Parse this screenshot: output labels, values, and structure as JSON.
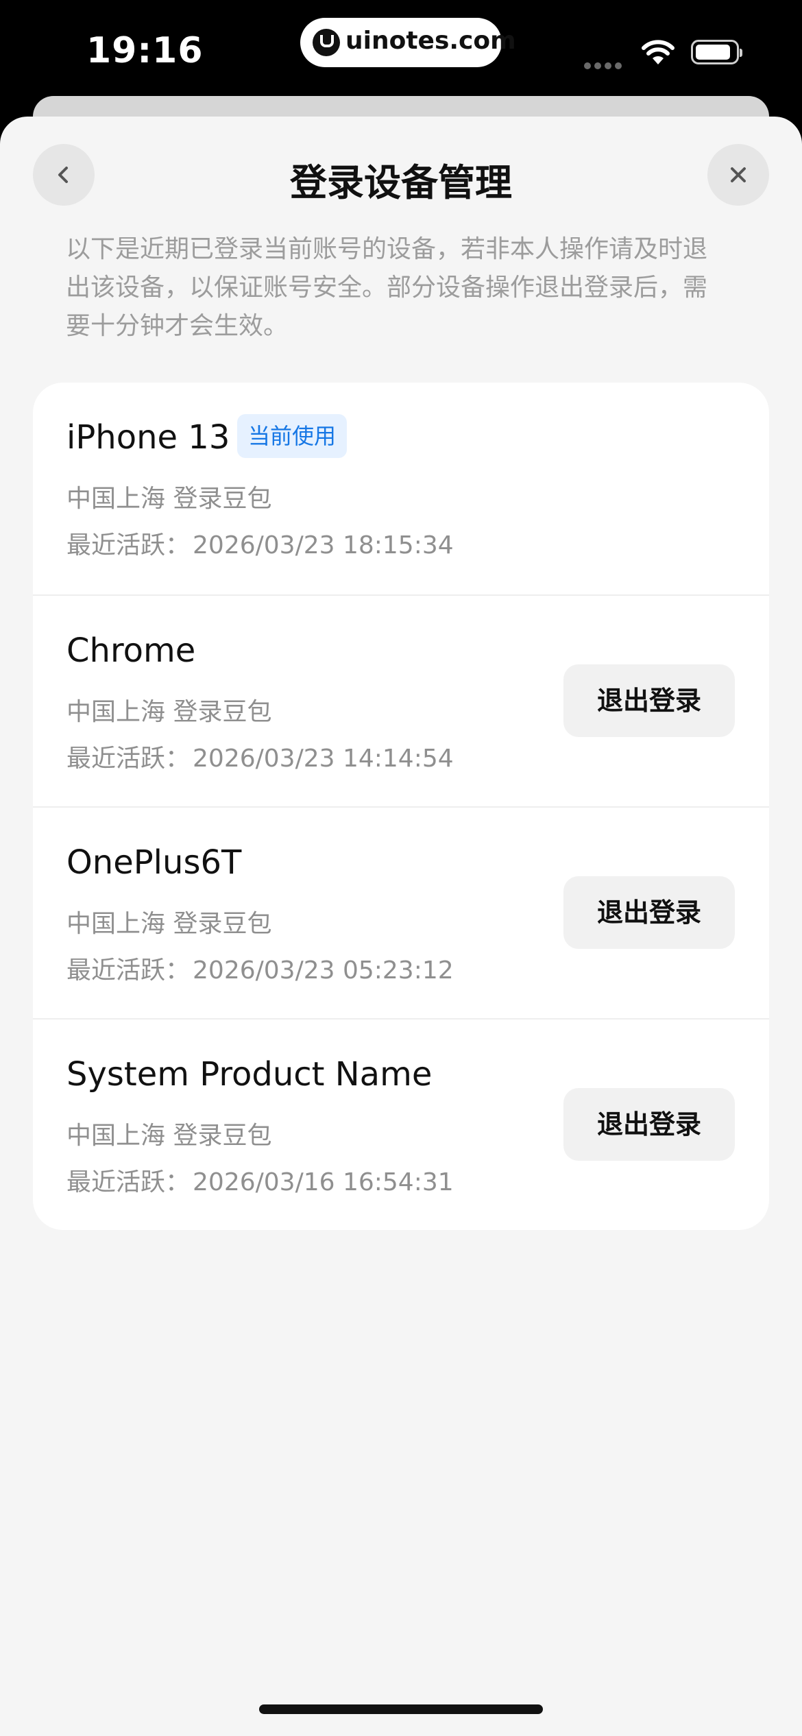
{
  "status_bar": {
    "time": "19:16",
    "url": "uinotes.com",
    "icons": [
      "signal-icon",
      "wifi-icon",
      "battery-icon"
    ]
  },
  "header": {
    "title": "登录设备管理",
    "back_icon": "chevron-left-icon",
    "close_icon": "close-icon"
  },
  "description": "以下是近期已登录当前账号的设备，若非本人操作请及时退\n出该设备，以保证账号安全。部分设备操作退出登录后，需\n要十分钟才会生效。",
  "devices": [
    {
      "name": "iPhone 13",
      "badge": "当前使用",
      "location": "中国上海 登录豆包",
      "active_label": "最近活跃：",
      "active_time": "2026/03/23 18:15:34"
    },
    {
      "name": "Chrome",
      "location": "中国上海 登录豆包",
      "active_label": "最近活跃：",
      "active_time": "2026/03/23 14:14:54",
      "button": "退出登录"
    },
    {
      "name": "OnePlus6T",
      "location": "中国上海 登录豆包",
      "active_label": "最近活跃：",
      "active_time": "2026/03/23 05:23:12",
      "button": "退出登录"
    },
    {
      "name": "System Product Name",
      "location": "中国上海 登录豆包",
      "active_label": "最近活跃：",
      "active_time": "2026/03/16 16:54:31",
      "button": "退出登录"
    }
  ],
  "colors": {
    "background": "#f5f5f5",
    "card": "#ffffff",
    "badge_bg": "#e6f1ff",
    "badge_text": "#1677e5",
    "secondary_text": "#8f8f8f",
    "button_bg": "#f1f1f1"
  }
}
